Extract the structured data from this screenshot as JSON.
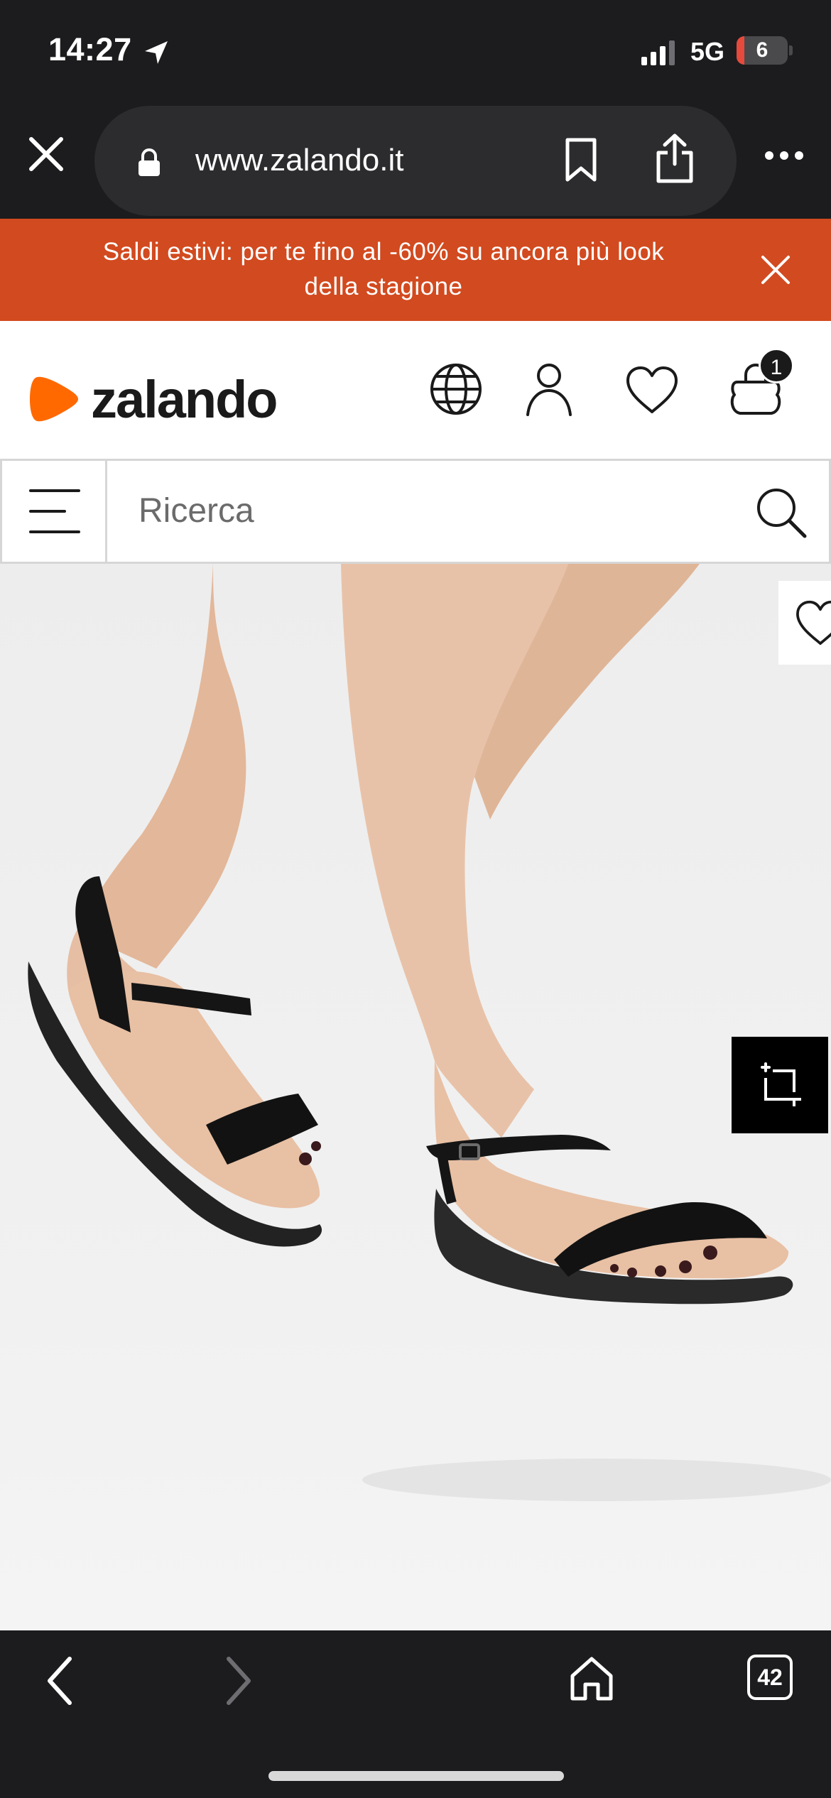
{
  "status_bar": {
    "time": "14:27",
    "network": "5G",
    "battery_level": "6",
    "battery_fraction": 0.06
  },
  "browser": {
    "url": "www.zalando.it",
    "tab_count": "42"
  },
  "promo_banner": {
    "line1": "Saldi estivi: per te fino al -60% su ancora più look",
    "line2": "della stagione"
  },
  "header": {
    "logo_text": "zalando",
    "bag_count": "1",
    "brand_color": "#ff6900"
  },
  "search": {
    "placeholder": "Ricerca"
  },
  "colors": {
    "chrome": "#1c1c1e",
    "promo": "#d24a1f",
    "brand": "#ff6900"
  },
  "icons": {
    "status": [
      "location-arrow-icon",
      "signal-icon",
      "battery-icon"
    ],
    "browser": [
      "close-icon",
      "lock-icon",
      "bookmark-icon",
      "share-icon",
      "more-icon"
    ],
    "header": [
      "globe-icon",
      "user-icon",
      "heart-icon",
      "bag-icon"
    ],
    "product": [
      "wishlist-heart-icon",
      "fullscreen-icon"
    ],
    "toolbar": [
      "back-icon",
      "forward-icon",
      "home-icon",
      "tabs-icon"
    ]
  }
}
